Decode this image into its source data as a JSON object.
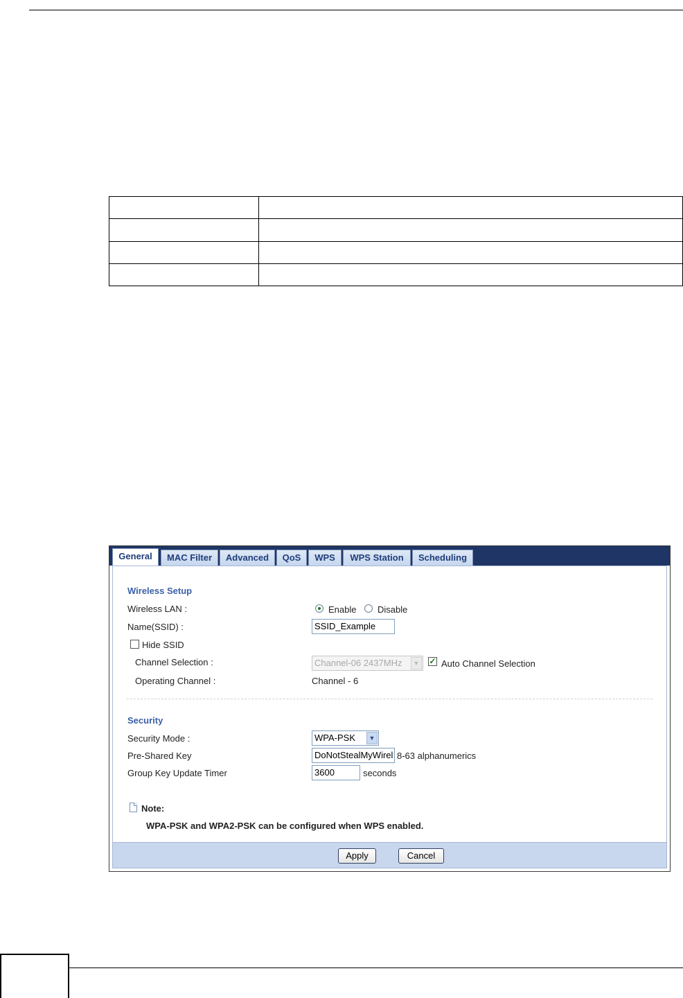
{
  "doc_table": {
    "rows": [
      [
        "",
        ""
      ],
      [
        "",
        ""
      ],
      [
        "",
        ""
      ],
      [
        "",
        ""
      ]
    ]
  },
  "tabs": [
    {
      "label": "General",
      "active": true
    },
    {
      "label": "MAC Filter",
      "active": false
    },
    {
      "label": "Advanced",
      "active": false
    },
    {
      "label": "QoS",
      "active": false
    },
    {
      "label": "WPS",
      "active": false
    },
    {
      "label": "WPS Station",
      "active": false
    },
    {
      "label": "Scheduling",
      "active": false
    }
  ],
  "wireless_setup": {
    "title": "Wireless Setup",
    "wireless_lan_label": "Wireless LAN :",
    "enable_label": "Enable",
    "disable_label": "Disable",
    "wireless_lan_value": "Enable",
    "ssid_label": "Name(SSID) :",
    "ssid_value": "SSID_Example",
    "hide_ssid_label": "Hide SSID",
    "hide_ssid_checked": false,
    "channel_selection_label": "Channel Selection :",
    "channel_selection_value": "Channel-06 2437MHz",
    "auto_channel_label": "Auto Channel Selection",
    "auto_channel_checked": true,
    "operating_channel_label": "Operating Channel :",
    "operating_channel_value": "Channel - 6"
  },
  "security": {
    "title": "Security",
    "mode_label": "Security Mode :",
    "mode_value": "WPA-PSK",
    "psk_label": "Pre-Shared Key",
    "psk_value": "DoNotStealMyWirel",
    "psk_hint": "8-63 alphanumerics",
    "timer_label": "Group Key Update Timer",
    "timer_value": "3600",
    "timer_unit": "seconds"
  },
  "note": {
    "title": "Note:",
    "text": "WPA-PSK and WPA2-PSK can be configured when WPS enabled."
  },
  "buttons": {
    "apply": "Apply",
    "cancel": "Cancel"
  }
}
